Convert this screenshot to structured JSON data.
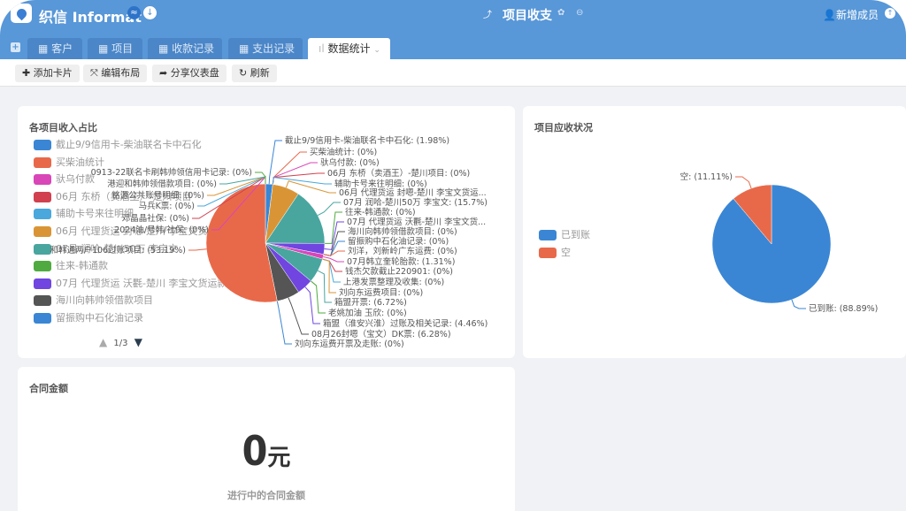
{
  "app": {
    "brand": "织信 Informat",
    "title": "项目收支",
    "add_member": "新增成员"
  },
  "tabs": [
    {
      "label": "客户"
    },
    {
      "label": "项目"
    },
    {
      "label": "收款记录"
    },
    {
      "label": "支出记录"
    },
    {
      "label": "数据统计",
      "active": true
    }
  ],
  "toolbar": {
    "add_card": "添加卡片",
    "edit_layout": "编辑布局",
    "share": "分享仪表盘",
    "refresh": "刷新"
  },
  "colors": {
    "header": "#5897d8",
    "palette": [
      "#3a86d4",
      "#e8694a",
      "#d946b8",
      "#d1404f",
      "#4aa8dc",
      "#d99535",
      "#48a69f",
      "#4fab3f",
      "#7045e0",
      "#555555"
    ]
  },
  "card1": {
    "title": "各项目收入占比",
    "legend": [
      "截止9/9信用卡-柴油联名卡中石化",
      "买柴油统计",
      "驮乌付款",
      "06月 东桥（卖酒王）-楚川项目",
      "辅助卡号来往明细",
      "06月 代理货运 封嗯-楚川 李宝文货运款A",
      "07月 润哈-楚川50万 李宝文",
      "往来-韩通款",
      "07月 代理货运 沃氍-楚川 李宝文货运款A",
      "海川向韩帅领借款项目",
      "留振购中石化油记录"
    ],
    "pager": "1/3"
  },
  "chart_data": [
    {
      "type": "pie",
      "title": "各项目收入占比",
      "slices": [
        {
          "label": "截止9/9信用卡-柴油联名卡中石化: (1.98%)",
          "value": 1.98
        },
        {
          "label": "买柴油统计: (0%)",
          "value": 0
        },
        {
          "label": "驮乌付款: (0%)",
          "value": 0
        },
        {
          "label": "06月 东桥（卖酒王）-楚川项目: (0%)",
          "value": 0
        },
        {
          "label": "辅助卡号来往明细: (0%)",
          "value": 0
        },
        {
          "label": "06月 代理货运 封嗯-楚川 李宝文货运...",
          "value": 7.4
        },
        {
          "label": "07月 润哈-楚川50万 李宝文: (15.7%)",
          "value": 15.7
        },
        {
          "label": "往来-韩通款: (0%)",
          "value": 0
        },
        {
          "label": "07月 代理货运 沃氍-楚川 李宝文货...",
          "value": 2.96
        },
        {
          "label": "海川向韩帅领借款项目: (0%)",
          "value": 0
        },
        {
          "label": "留振购中石化油记录: (0%)",
          "value": 0
        },
        {
          "label": "刘洋，刘新岭广东运费: (0%)",
          "value": 0
        },
        {
          "label": "07月韩立奎轮胎款: (1.31%)",
          "value": 1.31
        },
        {
          "label": "钱杰欠款截止220901: (0%)",
          "value": 0
        },
        {
          "label": "上港发票整理及收集: (0%)",
          "value": 0
        },
        {
          "label": "刘向东运费项目: (0%)",
          "value": 0
        },
        {
          "label": "箱盟开票: (6.72%)",
          "value": 6.72
        },
        {
          "label": "老姚加油 玉欣: (0%)",
          "value": 0
        },
        {
          "label": "箱盟（淮安兴淮）过账及相关记录: (4.46%)",
          "value": 4.46
        },
        {
          "label": "08月26封嗯（宝文）DK票: (6.28%)",
          "value": 6.28
        },
        {
          "label": "刘向东运费开票及走账: (0%)",
          "value": 0
        },
        {
          "label": "和韩通两户106过账项目: (53.19%)",
          "value": 53.19
        },
        {
          "label": "2024油/号韩/社保: (0%)",
          "value": 0
        },
        {
          "label": "邓晶晶社保: (0%)",
          "value": 0
        },
        {
          "label": "马兵K票: (0%)",
          "value": 0
        },
        {
          "label": "铭源公共账号明细: (0%)",
          "value": 0
        },
        {
          "label": "港迎和韩帅领借款项目: (0%)",
          "value": 0
        },
        {
          "label": "0913-22联名卡刷韩帅领信用卡记录: (0%)",
          "value": 0
        }
      ]
    },
    {
      "type": "pie",
      "title": "项目应收状况",
      "legend": [
        "已到账",
        "空"
      ],
      "slices": [
        {
          "label": "已到账: (88.89%)",
          "value": 88.89,
          "color": "#3a86d4"
        },
        {
          "label": "空: (11.11%)",
          "value": 11.11,
          "color": "#e8694a"
        }
      ]
    }
  ],
  "card2": {
    "title": "项目应收状况",
    "legend": [
      "已到账",
      "空"
    ]
  },
  "card3": {
    "title": "合同金额",
    "amount": "0",
    "unit": "元",
    "caption": "进行中的合同金额"
  }
}
